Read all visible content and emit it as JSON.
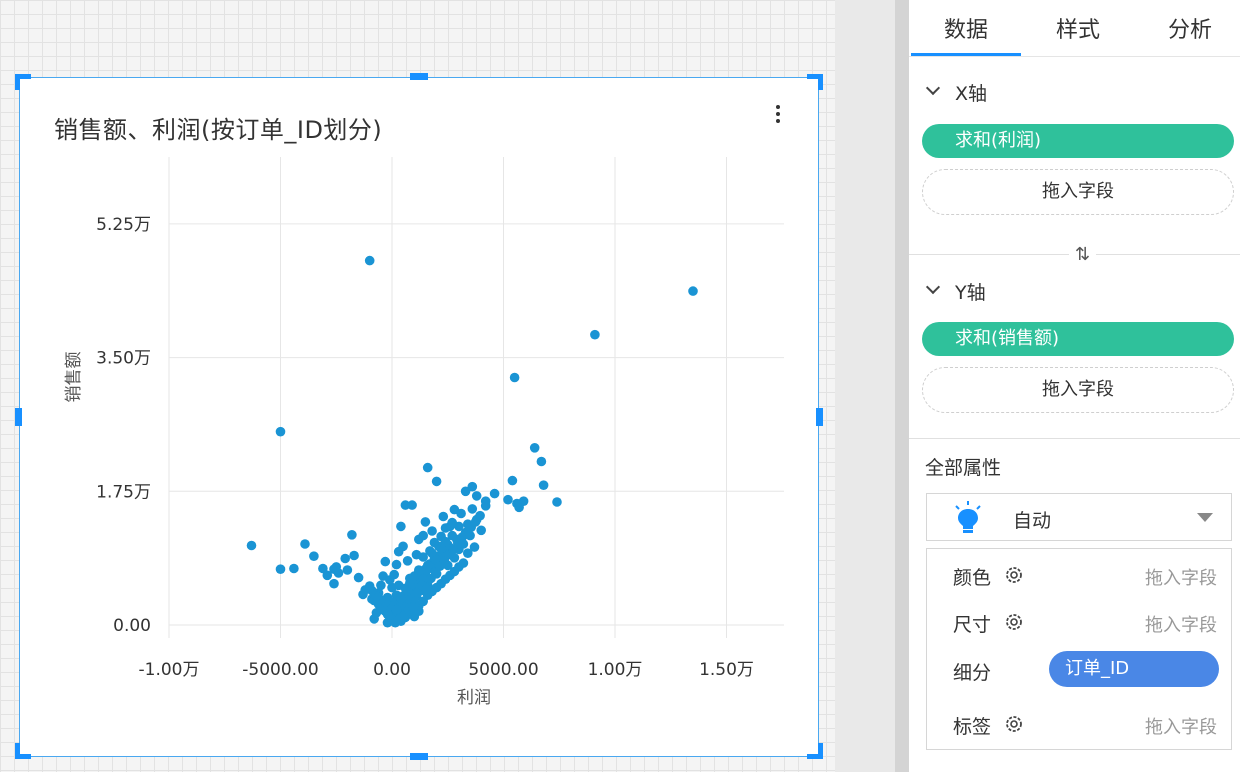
{
  "chart": {
    "title": "销售额、利润(按订单_ID划分)"
  },
  "chart_data": {
    "type": "scatter",
    "title": "销售额、利润(按订单_ID划分)",
    "xlabel": "利润",
    "ylabel": "销售额",
    "xlim": [
      -13000,
      17500
    ],
    "ylim": [
      0,
      58000
    ],
    "x_ticks": [
      {
        "value": -10000,
        "label": "-1.00万"
      },
      {
        "value": -5000,
        "label": "-5000.00"
      },
      {
        "value": 0,
        "label": "0.00"
      },
      {
        "value": 5000,
        "label": "5000.00"
      },
      {
        "value": 10000,
        "label": "1.00万"
      },
      {
        "value": 15000,
        "label": "1.50万"
      }
    ],
    "y_ticks": [
      {
        "value": 0,
        "label": "0.00"
      },
      {
        "value": 17500,
        "label": "1.75万"
      },
      {
        "value": 35000,
        "label": "3.50万"
      },
      {
        "value": 52500,
        "label": "5.25万"
      }
    ],
    "grid": true,
    "color": "#1a94d4",
    "points": [
      [
        -1000,
        47700
      ],
      [
        13500,
        43700
      ],
      [
        9100,
        38000
      ],
      [
        5500,
        32400
      ],
      [
        -5000,
        25300
      ],
      [
        6400,
        23200
      ],
      [
        6700,
        21400
      ],
      [
        1600,
        20600
      ],
      [
        5400,
        18900
      ],
      [
        6800,
        18300
      ],
      [
        7400,
        16100
      ],
      [
        5200,
        16400
      ],
      [
        5700,
        15400
      ],
      [
        5900,
        16200
      ],
      [
        5600,
        15900
      ],
      [
        -6300,
        10400
      ],
      [
        -5000,
        7300
      ],
      [
        -4400,
        7400
      ],
      [
        -3900,
        10600
      ],
      [
        -3500,
        9000
      ],
      [
        -3100,
        7400
      ],
      [
        -2900,
        6500
      ],
      [
        -2600,
        7300
      ],
      [
        -2400,
        6800
      ],
      [
        -2500,
        7600
      ],
      [
        -2600,
        5400
      ],
      [
        -2100,
        8700
      ],
      [
        -2000,
        7200
      ],
      [
        -1800,
        11800
      ],
      [
        -1700,
        9100
      ],
      [
        -1500,
        6200
      ],
      [
        -1300,
        4000
      ],
      [
        -1200,
        4600
      ],
      [
        -1000,
        5100
      ],
      [
        -900,
        3400
      ],
      [
        -600,
        4200
      ],
      [
        -500,
        5200
      ],
      [
        -400,
        6400
      ],
      [
        -300,
        8300
      ],
      [
        -200,
        3600
      ],
      [
        -100,
        2800
      ],
      [
        0,
        2200
      ],
      [
        100,
        1500
      ],
      [
        200,
        900
      ],
      [
        300,
        600
      ],
      [
        -300,
        1800
      ],
      [
        -500,
        2400
      ],
      [
        -700,
        1600
      ],
      [
        -800,
        800
      ],
      [
        -200,
        300
      ],
      [
        0,
        4900
      ],
      [
        200,
        3900
      ],
      [
        300,
        5200
      ],
      [
        400,
        2900
      ],
      [
        500,
        1900
      ],
      [
        600,
        3300
      ],
      [
        700,
        4600
      ],
      [
        800,
        6100
      ],
      [
        900,
        2600
      ],
      [
        1000,
        5600
      ],
      [
        1100,
        3800
      ],
      [
        1200,
        7000
      ],
      [
        1300,
        4500
      ],
      [
        1400,
        8900
      ],
      [
        1500,
        6300
      ],
      [
        1600,
        5200
      ],
      [
        1700,
        9700
      ],
      [
        1800,
        7400
      ],
      [
        1900,
        10800
      ],
      [
        2000,
        6700
      ],
      [
        2100,
        8100
      ],
      [
        2200,
        11600
      ],
      [
        2300,
        9300
      ],
      [
        2400,
        12700
      ],
      [
        2500,
        7800
      ],
      [
        2600,
        10100
      ],
      [
        2700,
        13400
      ],
      [
        2800,
        8800
      ],
      [
        2900,
        11200
      ],
      [
        3000,
        9900
      ],
      [
        3100,
        14600
      ],
      [
        3200,
        10600
      ],
      [
        3300,
        12100
      ],
      [
        3400,
        9400
      ],
      [
        3500,
        11700
      ],
      [
        3600,
        15200
      ],
      [
        3700,
        10200
      ],
      [
        3800,
        13800
      ],
      [
        4000,
        12400
      ],
      [
        4200,
        15600
      ],
      [
        3300,
        17500
      ],
      [
        3600,
        18100
      ],
      [
        2000,
        18800
      ],
      [
        900,
        15700
      ],
      [
        600,
        15700
      ],
      [
        400,
        12900
      ],
      [
        1500,
        13500
      ],
      [
        2300,
        14200
      ],
      [
        2800,
        15100
      ],
      [
        3800,
        16900
      ],
      [
        4200,
        16200
      ],
      [
        4600,
        17200
      ],
      [
        1200,
        11200
      ],
      [
        500,
        10300
      ],
      [
        700,
        8400
      ],
      [
        200,
        7900
      ],
      [
        100,
        6600
      ],
      [
        -100,
        5900
      ],
      [
        300,
        9600
      ],
      [
        1100,
        9200
      ],
      [
        1800,
        12300
      ],
      [
        2600,
        12900
      ],
      [
        3400,
        13200
      ],
      [
        2100,
        10300
      ],
      [
        1400,
        11700
      ],
      [
        200,
        1200
      ],
      [
        400,
        1700
      ],
      [
        600,
        2200
      ],
      [
        800,
        2800
      ],
      [
        1000,
        3400
      ],
      [
        1200,
        2500
      ],
      [
        1400,
        3100
      ],
      [
        1600,
        3900
      ],
      [
        1800,
        4400
      ],
      [
        2000,
        4900
      ],
      [
        2200,
        5400
      ],
      [
        2400,
        6000
      ],
      [
        2600,
        6500
      ],
      [
        2800,
        7000
      ],
      [
        3000,
        7600
      ],
      [
        3200,
        8100
      ],
      [
        -100,
        1100
      ],
      [
        100,
        400
      ],
      [
        300,
        1900
      ],
      [
        500,
        2600
      ],
      [
        700,
        3500
      ],
      [
        900,
        4200
      ],
      [
        1100,
        5000
      ],
      [
        1300,
        5800
      ],
      [
        1500,
        6800
      ],
      [
        1700,
        7500
      ],
      [
        1900,
        8300
      ],
      [
        2100,
        9000
      ],
      [
        2300,
        9800
      ],
      [
        2500,
        10500
      ],
      [
        0,
        700
      ],
      [
        -200,
        1400
      ],
      [
        -400,
        2000
      ],
      [
        -600,
        2700
      ],
      [
        -800,
        3200
      ],
      [
        100,
        2400
      ],
      [
        300,
        3100
      ],
      [
        500,
        3800
      ],
      [
        700,
        4500
      ],
      [
        900,
        5300
      ],
      [
        1100,
        6000
      ],
      [
        1300,
        6700
      ],
      [
        1500,
        7300
      ],
      [
        1700,
        8000
      ],
      [
        1900,
        8700
      ],
      [
        0,
        3000
      ],
      [
        200,
        2000
      ],
      [
        400,
        3500
      ],
      [
        600,
        4800
      ],
      [
        800,
        5500
      ],
      [
        1000,
        6400
      ],
      [
        1200,
        7200
      ],
      [
        1400,
        6000
      ],
      [
        1600,
        7800
      ],
      [
        1800,
        9400
      ],
      [
        2000,
        8500
      ],
      [
        2200,
        10000
      ],
      [
        2400,
        10900
      ],
      [
        2700,
        11700
      ],
      [
        3000,
        12900
      ],
      [
        -100,
        2500
      ],
      [
        -300,
        3000
      ],
      [
        -500,
        3300
      ],
      [
        -700,
        3800
      ],
      [
        -900,
        4500
      ],
      [
        400,
        500
      ],
      [
        600,
        1000
      ],
      [
        800,
        1500
      ],
      [
        1000,
        1100
      ],
      [
        1200,
        1800
      ],
      [
        150,
        300
      ],
      [
        350,
        800
      ],
      [
        550,
        1300
      ],
      [
        750,
        2000
      ],
      [
        950,
        2300
      ],
      [
        1150,
        4200
      ],
      [
        1350,
        5200
      ],
      [
        1550,
        4700
      ],
      [
        1750,
        6100
      ],
      [
        1950,
        6900
      ],
      [
        2150,
        7700
      ],
      [
        2350,
        8400
      ],
      [
        2550,
        9200
      ],
      [
        2750,
        9900
      ],
      [
        2950,
        10700
      ],
      [
        3150,
        11500
      ],
      [
        3350,
        11900
      ],
      [
        3550,
        12800
      ],
      [
        3750,
        13500
      ],
      [
        3950,
        14300
      ]
    ]
  },
  "panel": {
    "tabs": [
      "数据",
      "样式",
      "分析"
    ],
    "x_axis": {
      "label": "X轴",
      "field": "求和(利润)",
      "drop": "拖入字段"
    },
    "y_axis": {
      "label": "Y轴",
      "field": "求和(销售额)",
      "drop": "拖入字段"
    },
    "all_props_label": "全部属性",
    "mark_type": "自动",
    "marks": {
      "color": {
        "label": "颜色",
        "drop": "拖入字段"
      },
      "size": {
        "label": "尺寸",
        "drop": "拖入字段"
      },
      "segment": {
        "label": "细分",
        "field": "订单_ID"
      },
      "tag": {
        "label": "标签",
        "drop": "拖入字段"
      }
    },
    "colors": {
      "accent": "#1890ff",
      "field_green": "#2fc19b",
      "field_blue": "#4a87e6"
    }
  }
}
